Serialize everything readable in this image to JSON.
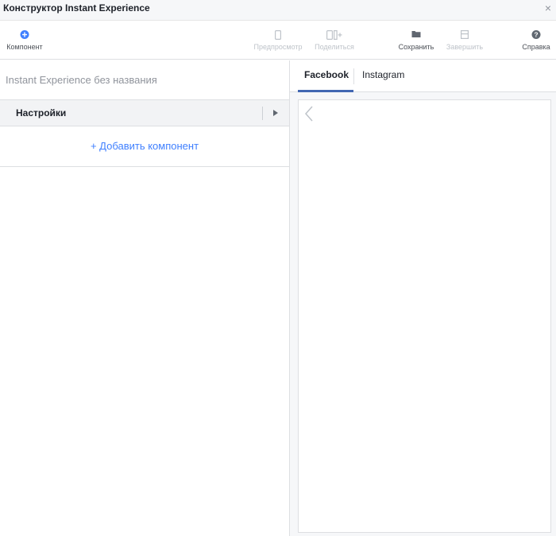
{
  "window": {
    "title": "Конструктор Instant Experience",
    "close_glyph": "×"
  },
  "toolbar": {
    "component_label": "Компонент",
    "preview_label": "Предпросмотр",
    "share_label": "Поделиться",
    "save_label": "Сохранить",
    "finish_label": "Завершить",
    "help_label": "Справка"
  },
  "left_panel": {
    "document_name": "Instant Experience без названия",
    "settings_label": "Настройки",
    "add_component_label": "+ Добавить компонент"
  },
  "right_panel": {
    "tabs": [
      {
        "label": "Facebook",
        "active": true
      },
      {
        "label": "Instagram",
        "active": false
      }
    ]
  },
  "colors": {
    "accent": "#4080ff",
    "tab_underline": "#4267b2",
    "disabled_text": "#bec3c9"
  },
  "icons": [
    "plus-circle-icon",
    "phone-icon",
    "share-phone-icon",
    "folder-icon",
    "finish-icon",
    "help-icon",
    "chevron-right-icon",
    "chevron-left-icon",
    "close-icon"
  ]
}
